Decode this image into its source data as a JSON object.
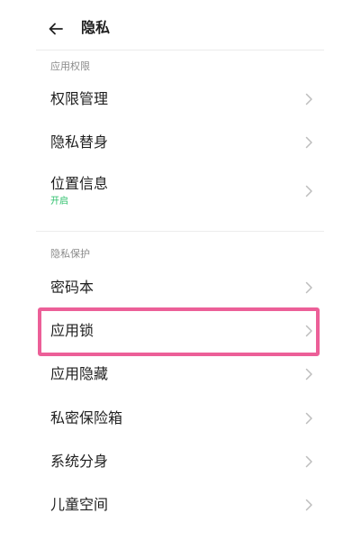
{
  "header": {
    "title": "隐私",
    "back_icon": "arrow-left-icon"
  },
  "sections": [
    {
      "label": "应用权限",
      "items": [
        {
          "title": "权限管理"
        },
        {
          "title": "隐私替身"
        },
        {
          "title": "位置信息",
          "subtitle": "开启"
        }
      ]
    },
    {
      "label": "隐私保护",
      "items": [
        {
          "title": "密码本"
        },
        {
          "title": "应用锁"
        },
        {
          "title": "应用隐藏"
        },
        {
          "title": "私密保险箱"
        },
        {
          "title": "系统分身"
        },
        {
          "title": "儿童空间"
        }
      ]
    }
  ],
  "colors": {
    "status_on": "#2bbf6a",
    "highlight": "#ec5f98",
    "chevron": "#bdbdbd"
  }
}
